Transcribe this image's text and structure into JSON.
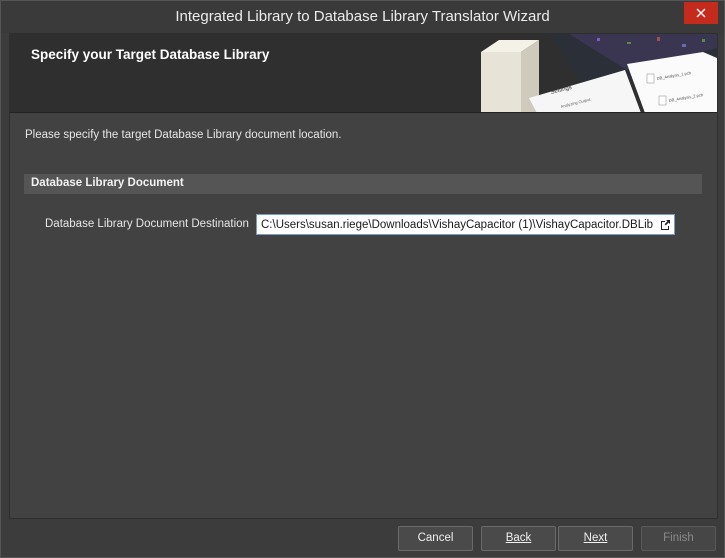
{
  "window": {
    "title": "Integrated Library to Database Library Translator Wizard",
    "close_icon": "close-icon",
    "accent_close_color": "#c42b1c"
  },
  "header": {
    "title": "Specify your Target Database Library",
    "art": {
      "menu_label": "Settings",
      "file_labels": [
        "Analyzing Output",
        "DB_Analysis_1.pcb",
        "DB_Analysis_2.pcb"
      ]
    }
  },
  "intro_text": "Please specify the target Database Library document location.",
  "section": {
    "title": "Database Library Document"
  },
  "destination": {
    "label": "Database Library Document Destination",
    "value": "C:\\Users\\susan.riege\\Downloads\\VishayCapacitor (1)\\VishayCapacitor.DBLib",
    "browse_icon": "open-folder-icon"
  },
  "buttons": {
    "cancel": "Cancel",
    "back": "Back",
    "next": "Next",
    "finish": "Finish"
  }
}
